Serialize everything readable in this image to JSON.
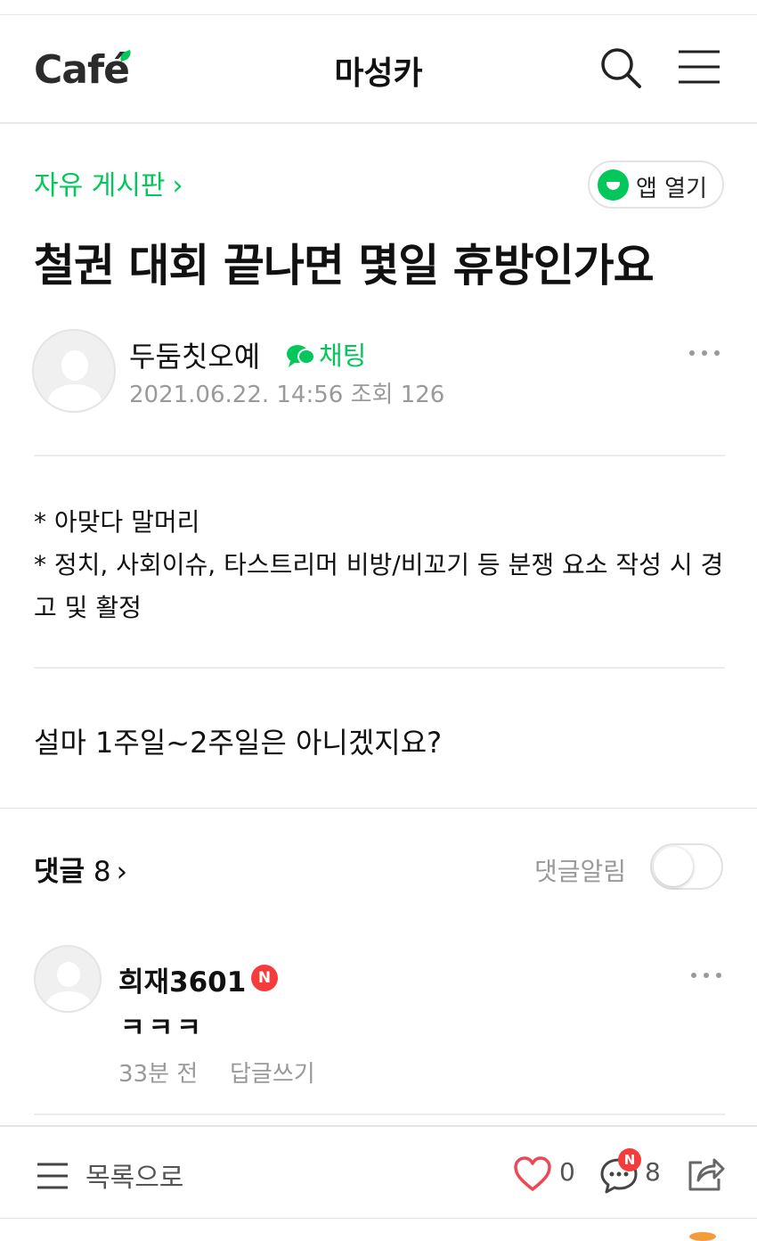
{
  "header": {
    "logo": "Café",
    "cafe_name": "마성카"
  },
  "article": {
    "board": "자유 게시판",
    "app_open_label": "앱 열기",
    "title": "철권 대회 끝나면 몇일 휴방인가요",
    "author": "두둠칫오예",
    "chat_label": "채팅",
    "meta": "2021.06.22. 14:56 조회 126",
    "notice_lines": [
      "* 아맞다 말머리",
      "* 정치, 사회이슈, 타스트리머 비방/비꼬기 등 분쟁 요소 작성 시 경고 및 활정"
    ],
    "body": "설마 1주일~2주일은 아니겠지요?"
  },
  "comments": {
    "label": "댓글",
    "count": "8",
    "notify_label": "댓글알림",
    "notify_on": false,
    "items": [
      {
        "author": "희재3601",
        "badge": "N",
        "text": "ㅋㅋㅋ",
        "time": "33분 전",
        "reply": "답글쓰기"
      }
    ]
  },
  "bottom_bar": {
    "list_label": "목록으로",
    "likes": "0",
    "comment_badge": "N",
    "comments": "8"
  },
  "colors": {
    "accent": "#03c75a",
    "badge": "#f53c3c"
  }
}
